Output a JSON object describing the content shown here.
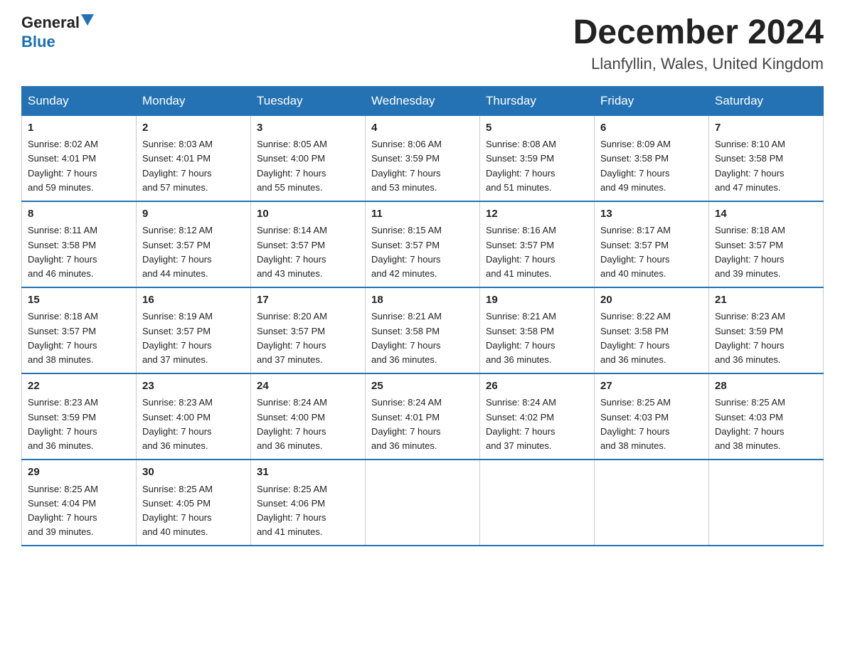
{
  "logo": {
    "general": "General",
    "triangle": "▲",
    "blue": "Blue"
  },
  "title": "December 2024",
  "location": "Llanfyllin, Wales, United Kingdom",
  "days_of_week": [
    "Sunday",
    "Monday",
    "Tuesday",
    "Wednesday",
    "Thursday",
    "Friday",
    "Saturday"
  ],
  "weeks": [
    [
      {
        "day": "1",
        "sunrise": "8:02 AM",
        "sunset": "4:01 PM",
        "daylight": "7 hours and 59 minutes."
      },
      {
        "day": "2",
        "sunrise": "8:03 AM",
        "sunset": "4:01 PM",
        "daylight": "7 hours and 57 minutes."
      },
      {
        "day": "3",
        "sunrise": "8:05 AM",
        "sunset": "4:00 PM",
        "daylight": "7 hours and 55 minutes."
      },
      {
        "day": "4",
        "sunrise": "8:06 AM",
        "sunset": "3:59 PM",
        "daylight": "7 hours and 53 minutes."
      },
      {
        "day": "5",
        "sunrise": "8:08 AM",
        "sunset": "3:59 PM",
        "daylight": "7 hours and 51 minutes."
      },
      {
        "day": "6",
        "sunrise": "8:09 AM",
        "sunset": "3:58 PM",
        "daylight": "7 hours and 49 minutes."
      },
      {
        "day": "7",
        "sunrise": "8:10 AM",
        "sunset": "3:58 PM",
        "daylight": "7 hours and 47 minutes."
      }
    ],
    [
      {
        "day": "8",
        "sunrise": "8:11 AM",
        "sunset": "3:58 PM",
        "daylight": "7 hours and 46 minutes."
      },
      {
        "day": "9",
        "sunrise": "8:12 AM",
        "sunset": "3:57 PM",
        "daylight": "7 hours and 44 minutes."
      },
      {
        "day": "10",
        "sunrise": "8:14 AM",
        "sunset": "3:57 PM",
        "daylight": "7 hours and 43 minutes."
      },
      {
        "day": "11",
        "sunrise": "8:15 AM",
        "sunset": "3:57 PM",
        "daylight": "7 hours and 42 minutes."
      },
      {
        "day": "12",
        "sunrise": "8:16 AM",
        "sunset": "3:57 PM",
        "daylight": "7 hours and 41 minutes."
      },
      {
        "day": "13",
        "sunrise": "8:17 AM",
        "sunset": "3:57 PM",
        "daylight": "7 hours and 40 minutes."
      },
      {
        "day": "14",
        "sunrise": "8:18 AM",
        "sunset": "3:57 PM",
        "daylight": "7 hours and 39 minutes."
      }
    ],
    [
      {
        "day": "15",
        "sunrise": "8:18 AM",
        "sunset": "3:57 PM",
        "daylight": "7 hours and 38 minutes."
      },
      {
        "day": "16",
        "sunrise": "8:19 AM",
        "sunset": "3:57 PM",
        "daylight": "7 hours and 37 minutes."
      },
      {
        "day": "17",
        "sunrise": "8:20 AM",
        "sunset": "3:57 PM",
        "daylight": "7 hours and 37 minutes."
      },
      {
        "day": "18",
        "sunrise": "8:21 AM",
        "sunset": "3:58 PM",
        "daylight": "7 hours and 36 minutes."
      },
      {
        "day": "19",
        "sunrise": "8:21 AM",
        "sunset": "3:58 PM",
        "daylight": "7 hours and 36 minutes."
      },
      {
        "day": "20",
        "sunrise": "8:22 AM",
        "sunset": "3:58 PM",
        "daylight": "7 hours and 36 minutes."
      },
      {
        "day": "21",
        "sunrise": "8:23 AM",
        "sunset": "3:59 PM",
        "daylight": "7 hours and 36 minutes."
      }
    ],
    [
      {
        "day": "22",
        "sunrise": "8:23 AM",
        "sunset": "3:59 PM",
        "daylight": "7 hours and 36 minutes."
      },
      {
        "day": "23",
        "sunrise": "8:23 AM",
        "sunset": "4:00 PM",
        "daylight": "7 hours and 36 minutes."
      },
      {
        "day": "24",
        "sunrise": "8:24 AM",
        "sunset": "4:00 PM",
        "daylight": "7 hours and 36 minutes."
      },
      {
        "day": "25",
        "sunrise": "8:24 AM",
        "sunset": "4:01 PM",
        "daylight": "7 hours and 36 minutes."
      },
      {
        "day": "26",
        "sunrise": "8:24 AM",
        "sunset": "4:02 PM",
        "daylight": "7 hours and 37 minutes."
      },
      {
        "day": "27",
        "sunrise": "8:25 AM",
        "sunset": "4:03 PM",
        "daylight": "7 hours and 38 minutes."
      },
      {
        "day": "28",
        "sunrise": "8:25 AM",
        "sunset": "4:03 PM",
        "daylight": "7 hours and 38 minutes."
      }
    ],
    [
      {
        "day": "29",
        "sunrise": "8:25 AM",
        "sunset": "4:04 PM",
        "daylight": "7 hours and 39 minutes."
      },
      {
        "day": "30",
        "sunrise": "8:25 AM",
        "sunset": "4:05 PM",
        "daylight": "7 hours and 40 minutes."
      },
      {
        "day": "31",
        "sunrise": "8:25 AM",
        "sunset": "4:06 PM",
        "daylight": "7 hours and 41 minutes."
      },
      null,
      null,
      null,
      null
    ]
  ],
  "labels": {
    "sunrise": "Sunrise:",
    "sunset": "Sunset:",
    "daylight": "Daylight:"
  }
}
